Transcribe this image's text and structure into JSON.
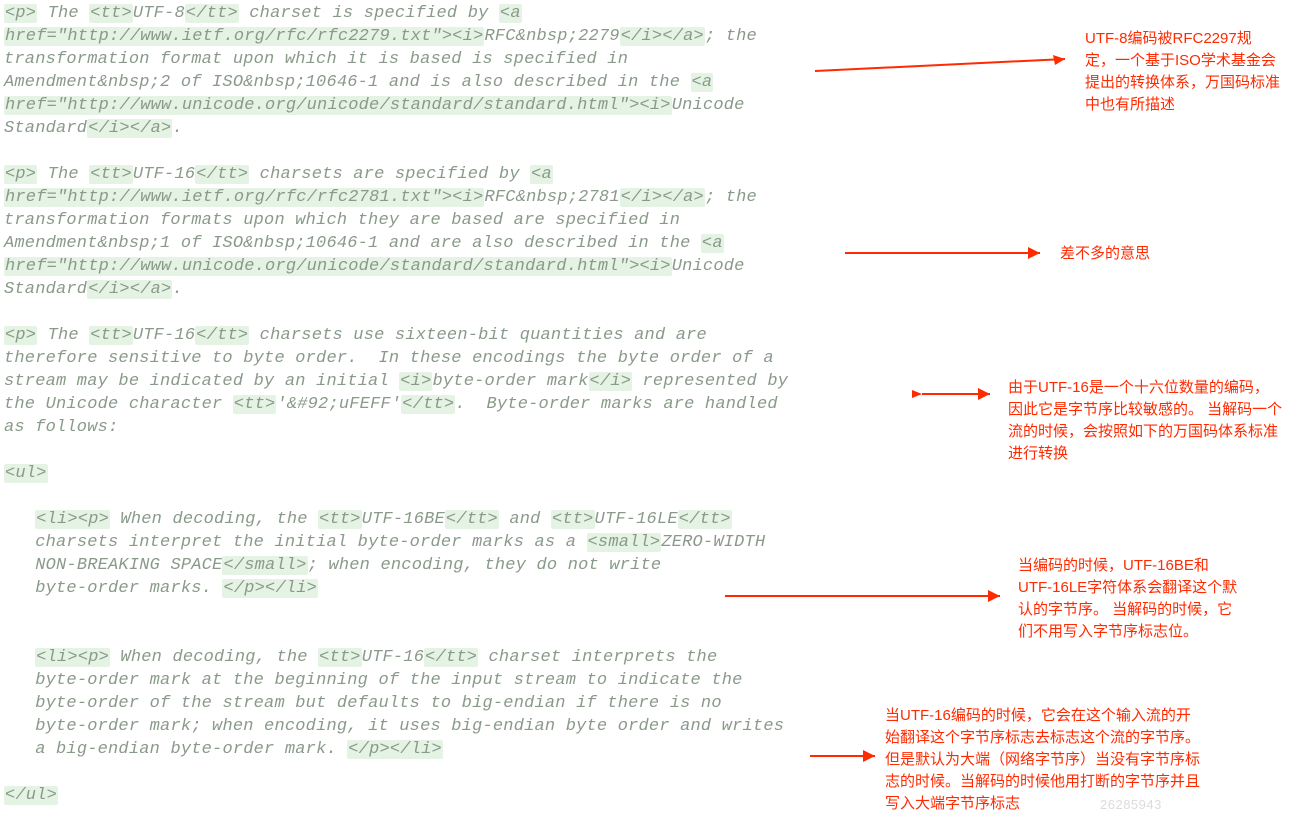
{
  "code": {
    "p1": {
      "t1": "<p>",
      "t2": " The ",
      "t3": "<tt>",
      "t4": "UTF-8",
      "t5": "</tt>",
      "t6": " charset is specified by ",
      "t7": "<a",
      "t8": "href=\"http://www.ietf.org/rfc/rfc2279.txt\"><i>",
      "t9": "RFC&nbsp;2279",
      "t10": "</i></a>",
      "t11": "; the",
      "t12": "transformation format upon which it is based is specified in",
      "t13": "Amendment&nbsp;2 of ISO&nbsp;10646-1 and is also described in the ",
      "t14": "<a",
      "t15": "href=\"http://www.unicode.org/unicode/standard/standard.html\"><i>",
      "t16": "Unicode",
      "t17": "Standard",
      "t18": "</i></a>",
      "t19": "."
    },
    "p2": {
      "t1": "<p>",
      "t2": " The ",
      "t3": "<tt>",
      "t4": "UTF-16",
      "t5": "</tt>",
      "t6": " charsets are specified by ",
      "t7": "<a",
      "t8": "href=\"http://www.ietf.org/rfc/rfc2781.txt\"><i>",
      "t9": "RFC&nbsp;2781",
      "t10": "</i></a>",
      "t11": "; the",
      "t12": "transformation formats upon which they are based are specified in",
      "t13": "Amendment&nbsp;1 of ISO&nbsp;10646-1 and are also described in the ",
      "t14": "<a",
      "t15": "href=\"http://www.unicode.org/unicode/standard/standard.html\"><i>",
      "t16": "Unicode",
      "t17": "Standard",
      "t18": "</i></a>",
      "t19": "."
    },
    "p3": {
      "t1": "<p>",
      "t2": " The ",
      "t3": "<tt>",
      "t4": "UTF-16",
      "t5": "</tt>",
      "t6": " charsets use sixteen-bit quantities and are",
      "t7": "therefore sensitive to byte order.  In these encodings the byte order of a",
      "t8": "stream may be indicated by an initial ",
      "t9": "<i>",
      "t10": "byte-order mark",
      "t11": "</i>",
      "t12": " represented by",
      "t13": "the Unicode character ",
      "t14": "<tt>",
      "t15": "'&#92;uFEFF'",
      "t16": "</tt>",
      "t17": ".  Byte-order marks are handled",
      "t18": "as follows:"
    },
    "ul_open": "<ul>",
    "li1": {
      "t1": "<li><p>",
      "t2": " When decoding, the ",
      "t3": "<tt>",
      "t4": "UTF-16BE",
      "t5": "</tt>",
      "t6": " and ",
      "t7": "<tt>",
      "t8": "UTF-16LE",
      "t9": "</tt>",
      "t10": "charsets interpret the initial byte-order marks as a ",
      "t11": "<small>",
      "t12": "ZERO-WIDTH",
      "t13": "NON-BREAKING SPACE",
      "t14": "</small>",
      "t15": "; when encoding, they do not write",
      "t16": "byte-order marks. ",
      "t17": "</p></li>"
    },
    "li2": {
      "t1": "<li><p>",
      "t2": " When decoding, the ",
      "t3": "<tt>",
      "t4": "UTF-16",
      "t5": "</tt>",
      "t6": " charset interprets the",
      "t7": "byte-order mark at the beginning of the input stream to indicate the",
      "t8": "byte-order of the stream but defaults to big-endian if there is no",
      "t9": "byte-order mark; when encoding, it uses big-endian byte order and writes",
      "t10": "a big-endian byte-order mark. ",
      "t11": "</p></li>"
    },
    "ul_close": "</ul>"
  },
  "annotations": {
    "a1": "UTF-8编码被RFC2297规定，一个基于ISO学术基金会提出的转换体系，万国码标准中也有所描述",
    "a2": "差不多的意思",
    "a3": "由于UTF-16是一个十六位数量的编码，因此它是字节序比较敏感的。  当解码一个流的时候，会按照如下的万国码体系标准进行转换",
    "a4": "当编码的时候，UTF-16BE和UTF-16LE字符体系会翻译这个默认的字节序。  当解码的时候，它们不用写入字节序标志位。",
    "a5": "当UTF-16编码的时候，它会在这个输入流的开始翻译这个字节序标志去标志这个流的字节序。  但是默认为大端（网络字节序）当没有字节序标志的时候。当解码的时候他用打断的字节序并且写入大端字节序标志"
  },
  "watermark": "26285943"
}
